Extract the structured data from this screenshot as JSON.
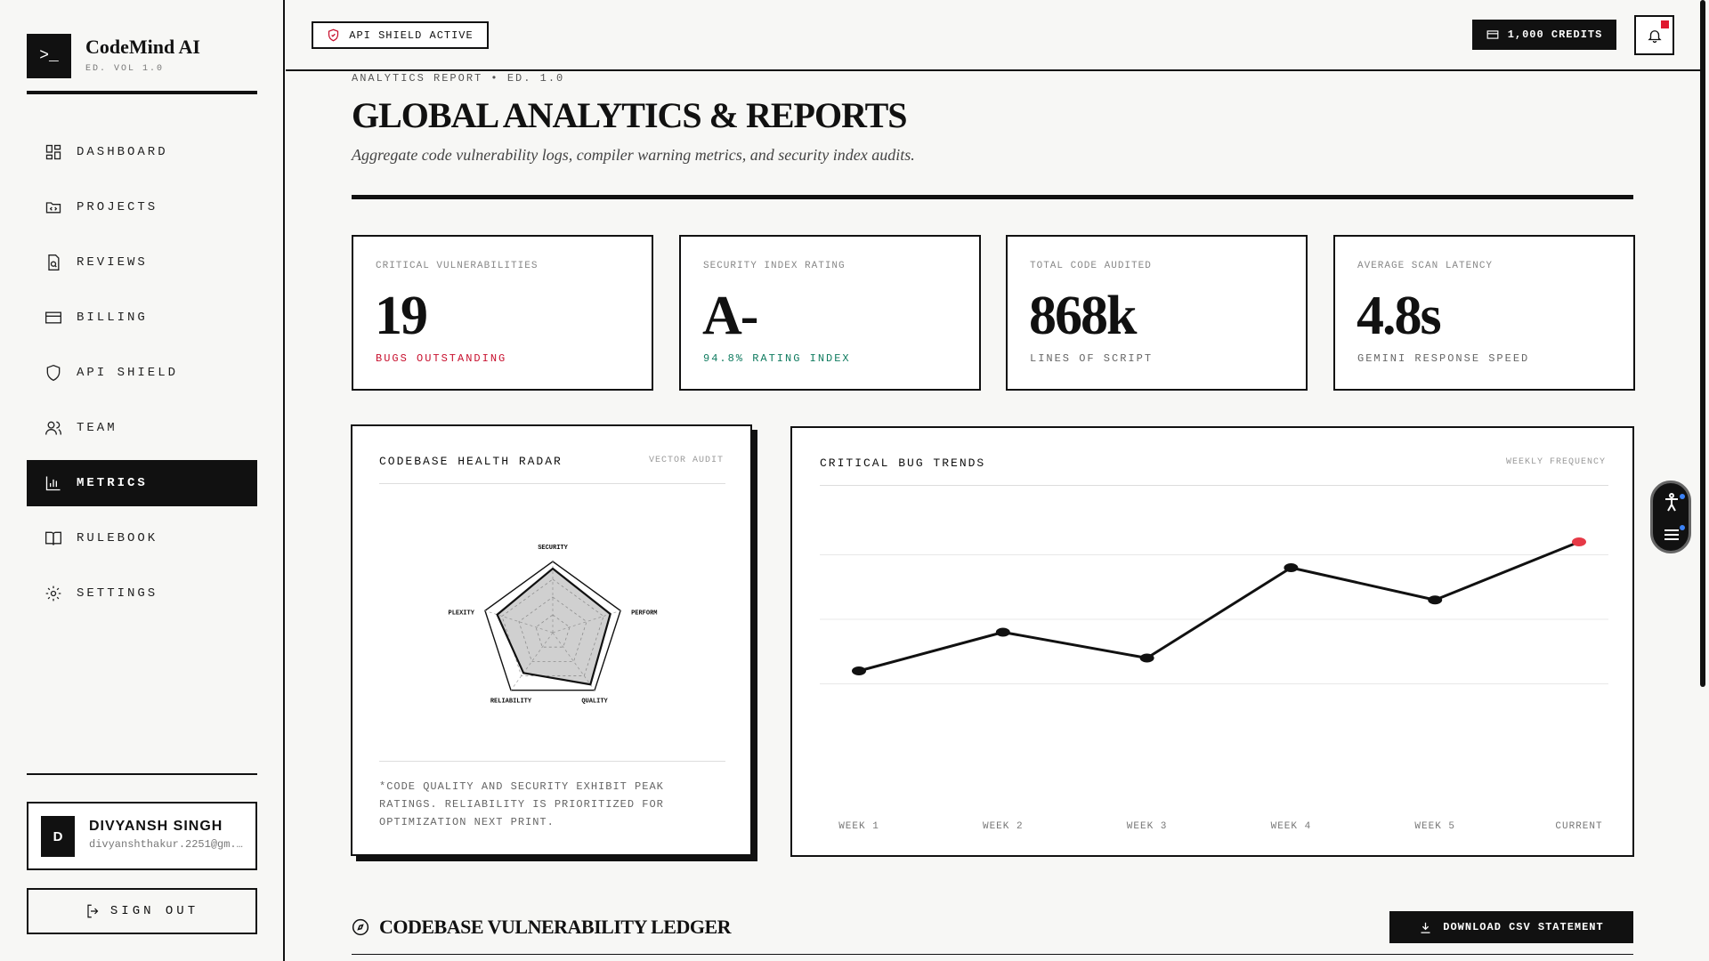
{
  "brand": {
    "logo_glyph": ">_",
    "name": "CodeMind AI",
    "subtitle": "ED. VOL 1.0"
  },
  "sidebar": {
    "items": [
      {
        "label": "DASHBOARD",
        "icon": "dashboard-icon"
      },
      {
        "label": "PROJECTS",
        "icon": "folder-code-icon"
      },
      {
        "label": "REVIEWS",
        "icon": "file-search-icon"
      },
      {
        "label": "BILLING",
        "icon": "credit-card-icon"
      },
      {
        "label": "API SHIELD",
        "icon": "shield-icon"
      },
      {
        "label": "TEAM",
        "icon": "users-icon"
      },
      {
        "label": "METRICS",
        "icon": "bar-chart-icon",
        "active": true
      },
      {
        "label": "RULEBOOK",
        "icon": "book-open-icon"
      },
      {
        "label": "SETTINGS",
        "icon": "gear-icon"
      }
    ]
  },
  "user": {
    "initial": "D",
    "name": "DIVYANSH SINGH",
    "email": "divyanshthakur.2251@gm..."
  },
  "signout_label": "SIGN OUT",
  "topbar": {
    "shield_badge": "API SHIELD ACTIVE",
    "credits": "1,000 CREDITS"
  },
  "header": {
    "eyebrow": "ANALYTICS REPORT • ED. 1.0",
    "title": "GLOBAL ANALYTICS & REPORTS",
    "subtitle": "Aggregate code vulnerability logs, compiler warning metrics, and security index audits."
  },
  "stats": [
    {
      "label": "CRITICAL VULNERABILITIES",
      "value": "19",
      "note": "BUGS OUTSTANDING",
      "note_color": "#c8102e"
    },
    {
      "label": "SECURITY INDEX RATING",
      "value": "A-",
      "note": "94.8% RATING INDEX",
      "note_color": "#0f7b5f"
    },
    {
      "label": "TOTAL CODE AUDITED",
      "value": "868k",
      "note": "LINES OF SCRIPT",
      "note_color": "#666666"
    },
    {
      "label": "AVERAGE SCAN LATENCY",
      "value": "4.8s",
      "note": "GEMINI RESPONSE SPEED",
      "note_color": "#666666"
    }
  ],
  "radar": {
    "title": "CODEBASE HEALTH RADAR",
    "tag": "VECTOR AUDIT",
    "note": "*CODE QUALITY AND SECURITY EXHIBIT PEAK RATINGS. RELIABILITY IS PRIORITIZED FOR OPTIMIZATION NEXT PRINT."
  },
  "trend": {
    "title": "CRITICAL BUG TRENDS",
    "tag": "WEEKLY FREQUENCY"
  },
  "ledger": {
    "title": "CODEBASE VULNERABILITY LEDGER",
    "download_label": "DOWNLOAD CSV STATEMENT"
  },
  "chart_data": [
    {
      "type": "radar",
      "title": "CODEBASE HEALTH RADAR",
      "axes": [
        "SECURITY",
        "PERFORM",
        "QUALITY",
        "RELIABILITY",
        "PLEXITY"
      ],
      "range": [
        0,
        100
      ],
      "values": [
        90,
        85,
        90,
        70,
        82
      ]
    },
    {
      "type": "line",
      "title": "CRITICAL BUG TRENDS",
      "categories": [
        "WEEK 1",
        "WEEK 2",
        "WEEK 3",
        "WEEK 4",
        "WEEK 5",
        "CURRENT"
      ],
      "values": [
        12,
        18,
        14,
        28,
        23,
        32
      ],
      "ylim": [
        0,
        40
      ],
      "highlight_last_color": "#e63946"
    }
  ]
}
